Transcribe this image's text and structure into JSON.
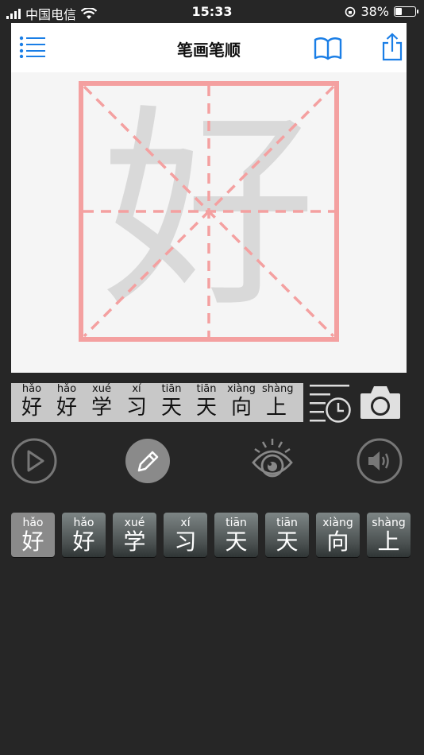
{
  "status": {
    "carrier": "中国电信",
    "time": "15:33",
    "battery": "38%",
    "battery_level": 0.38
  },
  "navbar": {
    "title": "笔画笔顺",
    "menu_icon": "list-icon",
    "book_icon": "book-icon",
    "share_icon": "share-icon"
  },
  "canvas": {
    "character": "好",
    "grid_color": "#f4a0a0",
    "char_color": "#d9d9d9"
  },
  "strip": {
    "items": [
      {
        "pinyin": "hǎo",
        "hanzi": "好"
      },
      {
        "pinyin": "hǎo",
        "hanzi": "好"
      },
      {
        "pinyin": "xué",
        "hanzi": "学"
      },
      {
        "pinyin": "xí",
        "hanzi": "习"
      },
      {
        "pinyin": "tiān",
        "hanzi": "天"
      },
      {
        "pinyin": "tiān",
        "hanzi": "天"
      },
      {
        "pinyin": "xiàng",
        "hanzi": "向"
      },
      {
        "pinyin": "shàng",
        "hanzi": "上"
      }
    ]
  },
  "controls": {
    "history_icon": "history-list-icon",
    "camera_icon": "camera-icon",
    "play_icon": "play-icon",
    "pencil_icon": "pencil-icon",
    "eye_icon": "eye-icon",
    "sound_icon": "speaker-icon"
  },
  "characters": {
    "active_index": 0,
    "items": [
      {
        "pinyin": "hǎo",
        "hanzi": "好"
      },
      {
        "pinyin": "hǎo",
        "hanzi": "好"
      },
      {
        "pinyin": "xué",
        "hanzi": "学"
      },
      {
        "pinyin": "xí",
        "hanzi": "习"
      },
      {
        "pinyin": "tiān",
        "hanzi": "天"
      },
      {
        "pinyin": "tiān",
        "hanzi": "天"
      },
      {
        "pinyin": "xiàng",
        "hanzi": "向"
      },
      {
        "pinyin": "shàng",
        "hanzi": "上"
      }
    ]
  }
}
